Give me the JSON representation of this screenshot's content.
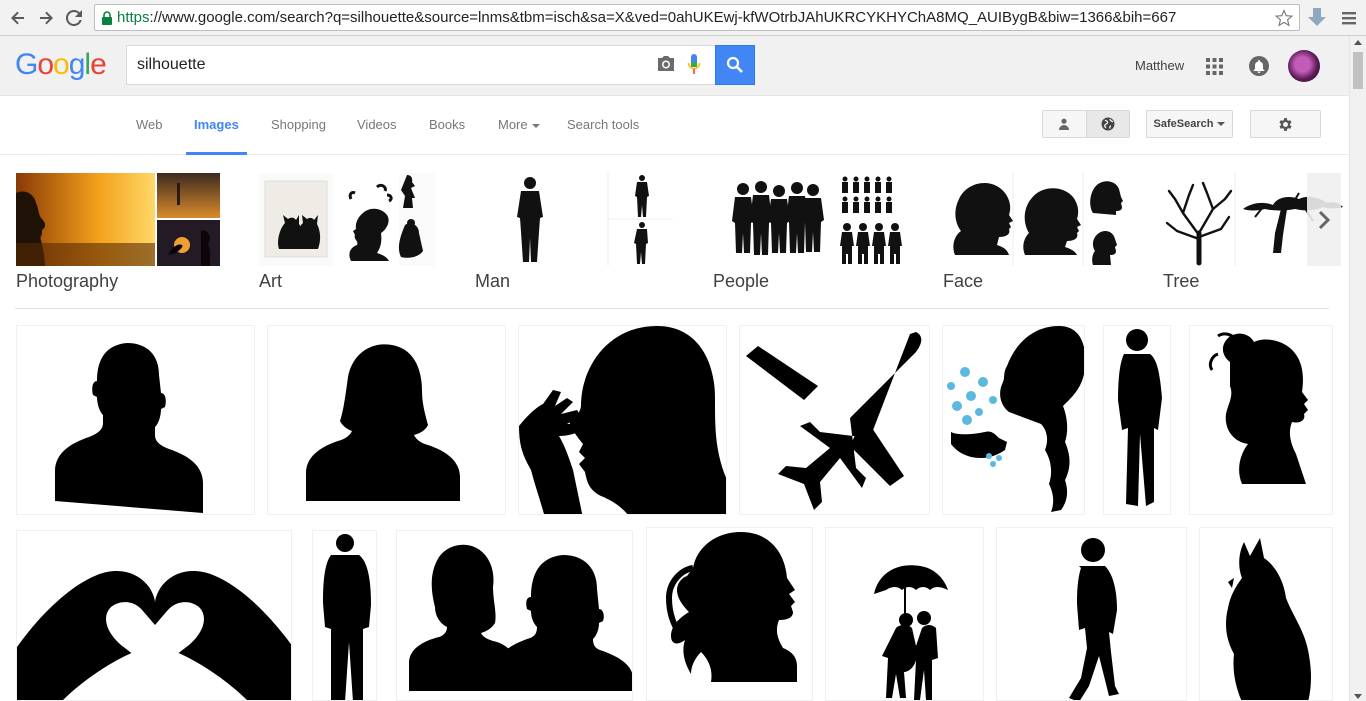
{
  "browser": {
    "url_scheme": "https",
    "url_rest": "://www.google.com/search?q=silhouette&source=lnms&tbm=isch&sa=X&ved=0ahUKEwj-kfWOtrbJAhUKRCYKHYChA8MQ_AUIBygB&biw=1366&bih=667"
  },
  "header": {
    "logo_letters": [
      "G",
      "o",
      "o",
      "g",
      "l",
      "e"
    ],
    "search_query": "silhouette",
    "username": "Matthew"
  },
  "tabs": [
    {
      "label": "Web"
    },
    {
      "label": "Images",
      "active": true
    },
    {
      "label": "Shopping"
    },
    {
      "label": "Videos"
    },
    {
      "label": "Books"
    },
    {
      "label": "More"
    },
    {
      "label": "Search tools"
    }
  ],
  "toolbar": {
    "safesearch_label": "SafeSearch"
  },
  "related_topics": [
    {
      "label": "Photography"
    },
    {
      "label": "Art"
    },
    {
      "label": "Man"
    },
    {
      "label": "People"
    },
    {
      "label": "Face"
    },
    {
      "label": "Tree"
    }
  ],
  "colors": {
    "accent": "#4285f4",
    "logo_blue": "#4285f4",
    "logo_red": "#ea4335",
    "logo_yellow": "#fbbc05",
    "logo_green": "#34a853",
    "secure_green": "#0b8043"
  },
  "image_results": [
    {
      "subject": "man head and shoulders silhouette"
    },
    {
      "subject": "woman head and shoulders silhouette"
    },
    {
      "subject": "thinking face profile silhouette"
    },
    {
      "subject": "airplane silhouette"
    },
    {
      "subject": "woman with braid blowing snowflakes silhouette"
    },
    {
      "subject": "standing man silhouette"
    },
    {
      "subject": "woman with bun profile silhouette"
    },
    {
      "subject": "heart hands silhouette"
    },
    {
      "subject": "man in coat silhouette"
    },
    {
      "subject": "couple busts silhouette"
    },
    {
      "subject": "ponytail girl profile silhouette"
    },
    {
      "subject": "couple under umbrella silhouette"
    },
    {
      "subject": "walking man silhouette"
    },
    {
      "subject": "howling wolf silhouette"
    }
  ]
}
